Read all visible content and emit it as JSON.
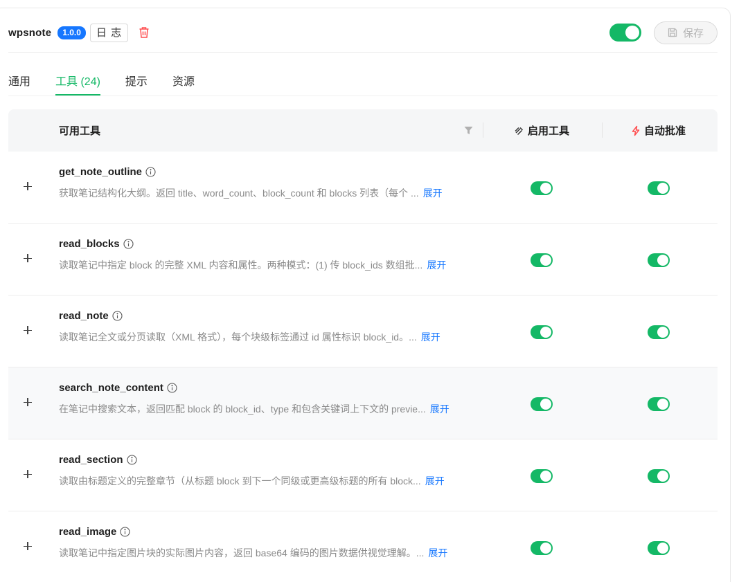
{
  "header": {
    "plugin_name": "wpsnote",
    "version": "1.0.0",
    "log_label": "日 志",
    "plugin_enabled": true,
    "save_label": "保存"
  },
  "tabs": [
    {
      "label": "通用",
      "active": false
    },
    {
      "label": "工具 (24)",
      "active": true
    },
    {
      "label": "提示",
      "active": false
    },
    {
      "label": "资源",
      "active": false
    }
  ],
  "table": {
    "headers": {
      "tools": "可用工具",
      "enabled": "启用工具",
      "auto_approve": "自动批准"
    },
    "expand_label": "展开",
    "rows": [
      {
        "name": "get_note_outline",
        "description": "获取笔记结构化大纲。返回 title、word_count、block_count 和 blocks 列表（每个 ...",
        "enabled": true,
        "auto_approve": true
      },
      {
        "name": "read_blocks",
        "description": "读取笔记中指定 block 的完整 XML 内容和属性。两种模式：(1) 传 block_ids 数组批...",
        "enabled": true,
        "auto_approve": true
      },
      {
        "name": "read_note",
        "description": "读取笔记全文或分页读取（XML 格式），每个块级标签通过 id 属性标识 block_id。...",
        "enabled": true,
        "auto_approve": true
      },
      {
        "name": "search_note_content",
        "description": "在笔记中搜索文本，返回匹配 block 的 block_id、type 和包含关键词上下文的 previe...",
        "enabled": true,
        "auto_approve": true
      },
      {
        "name": "read_section",
        "description": "读取由标题定义的完整章节（从标题 block 到下一个同级或更高级标题的所有 block...",
        "enabled": true,
        "auto_approve": true
      },
      {
        "name": "read_image",
        "description": "读取笔记中指定图片块的实际图片内容，返回 base64 编码的图片数据供视觉理解。...",
        "enabled": true,
        "auto_approve": true
      }
    ]
  },
  "colors": {
    "accent": "#14b866",
    "link": "#1677ff",
    "badge": "#1677ff",
    "danger": "#ff4d4f"
  },
  "icons": {
    "delete": "trash-icon",
    "save": "floppy-disk-icon",
    "filter": "filter-icon",
    "enabled": "tool-icon",
    "auto_approve": "lightning-icon",
    "info": "info-icon",
    "expand": "plus-icon"
  }
}
